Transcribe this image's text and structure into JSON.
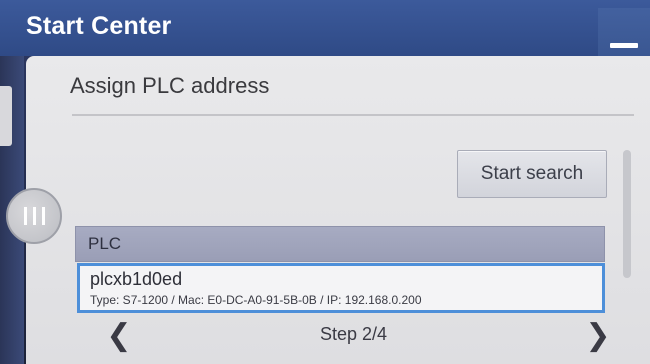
{
  "titlebar": {
    "title": "Start Center",
    "minimize_icon": "minimize-icon"
  },
  "panel": {
    "header": "Assign PLC address",
    "start_search_label": "Start search",
    "menu_handle_icon": "three-lines-icon"
  },
  "list": {
    "header": "PLC",
    "items": [
      {
        "name": "plcxb1d0ed",
        "details": "Type: S7-1200 / Mac: E0-DC-A0-91-5B-0B / IP: 192.168.0.200"
      }
    ]
  },
  "navigation": {
    "prev": "❮",
    "step": "Step 2/4",
    "next": "❯"
  },
  "colors": {
    "titlebar": "#3c5a9b",
    "panel_bg": "#e9e9eb",
    "list_header_bg": "#a7abc2",
    "selected_border": "#4d8fd9"
  }
}
